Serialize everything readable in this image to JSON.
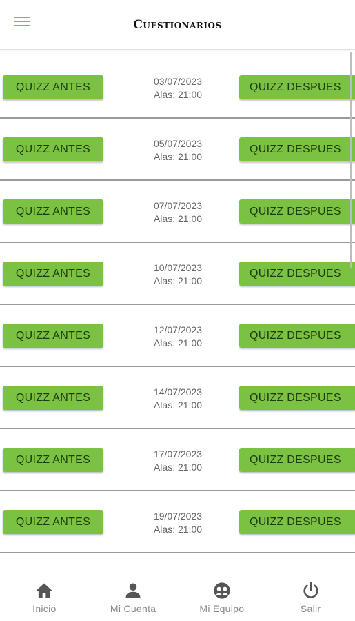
{
  "header": {
    "title": "Cuestionarios"
  },
  "rows": [
    {
      "antes_label": "QUIZZ ANTES",
      "date": "03/07/2023",
      "time": "Alas: 21:00",
      "despues_label": "QUIZZ DESPUES"
    },
    {
      "antes_label": "QUIZZ ANTES",
      "date": "05/07/2023",
      "time": "Alas: 21:00",
      "despues_label": "QUIZZ DESPUES"
    },
    {
      "antes_label": "QUIZZ ANTES",
      "date": "07/07/2023",
      "time": "Alas: 21:00",
      "despues_label": "QUIZZ DESPUES"
    },
    {
      "antes_label": "QUIZZ ANTES",
      "date": "10/07/2023",
      "time": "Alas: 21:00",
      "despues_label": "QUIZZ DESPUES"
    },
    {
      "antes_label": "QUIZZ ANTES",
      "date": "12/07/2023",
      "time": "Alas: 21:00",
      "despues_label": "QUIZZ DESPUES"
    },
    {
      "antes_label": "QUIZZ ANTES",
      "date": "14/07/2023",
      "time": "Alas: 21:00",
      "despues_label": "QUIZZ DESPUES"
    },
    {
      "antes_label": "QUIZZ ANTES",
      "date": "17/07/2023",
      "time": "Alas: 21:00",
      "despues_label": "QUIZZ DESPUES"
    },
    {
      "antes_label": "QUIZZ ANTES",
      "date": "19/07/2023",
      "time": "Alas: 21:00",
      "despues_label": "QUIZZ DESPUES"
    }
  ],
  "bottom_nav": [
    {
      "label": "Inicio",
      "icon": "home-icon"
    },
    {
      "label": "Mi Cuenta",
      "icon": "user-icon"
    },
    {
      "label": "Mi Equipo",
      "icon": "team-icon"
    },
    {
      "label": "Salir",
      "icon": "power-icon"
    }
  ],
  "colors": {
    "accent": "#7cc242",
    "menu_icon": "#7cbf3d",
    "nav_icon": "#555555"
  }
}
